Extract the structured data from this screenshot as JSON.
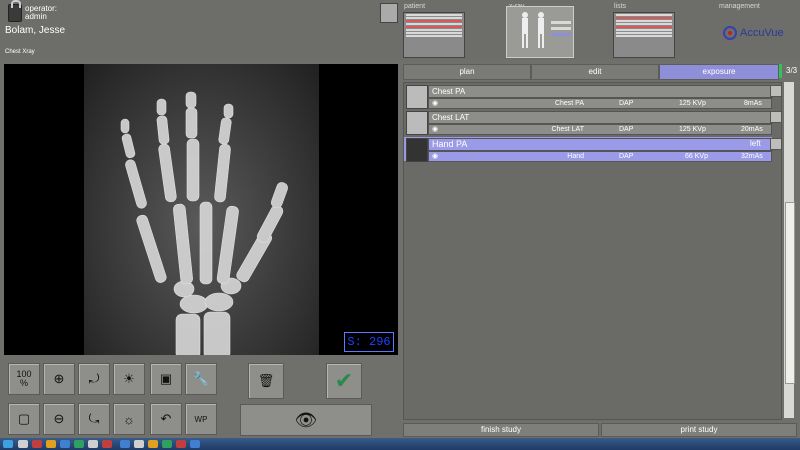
{
  "operator_label": "operator:",
  "operator_name": "admin",
  "patient_name": "Bolam,  Jesse",
  "exam_title": "Chest Xray",
  "nav": {
    "patient": "patient",
    "xray": "x-ray",
    "lists": "lists",
    "management": "management"
  },
  "logo": "AccuVue",
  "image": {
    "s_value": "S: 296"
  },
  "tabs": [
    "plan",
    "edit",
    "exposure"
  ],
  "active_tab": "exposure",
  "counter": "3/3",
  "studies": [
    {
      "title": "Chest PA",
      "name": "Chest PA",
      "dose": "DAP",
      "kvp": "125 KVp",
      "mas": "8mAs",
      "side": ""
    },
    {
      "title": "Chest LAT",
      "name": "Chest LAT",
      "dose": "DAP",
      "kvp": "125 KVp",
      "mas": "20mAs",
      "side": ""
    },
    {
      "title": "Hand PA",
      "name": "Hand",
      "dose": "DAP",
      "kvp": "66 KVp",
      "mas": "32mAs",
      "side": "left"
    }
  ],
  "tools": {
    "zoom100": "100\n%",
    "wp": "WP"
  },
  "buttons": {
    "finish": "finish study",
    "print": "print study"
  },
  "colors": {
    "accent": "#8f8fd9",
    "s_value": "#2040ff"
  }
}
